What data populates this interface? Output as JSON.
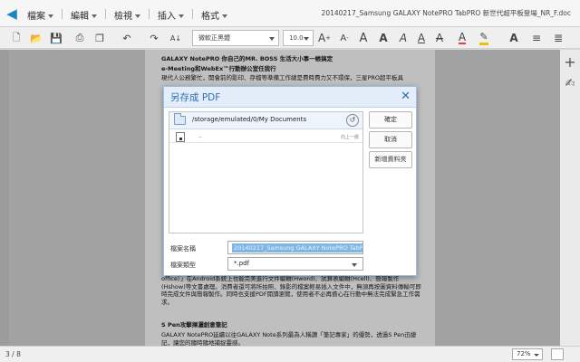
{
  "menubar": {
    "menus": [
      {
        "label": "檔案"
      },
      {
        "label": "編輯"
      },
      {
        "label": "檢視"
      },
      {
        "label": "插入"
      },
      {
        "label": "格式"
      }
    ],
    "doc_title": "20140217_Samsung GALAXY NotePRO TabPRO 新世代超平板登場_NR_F.doc"
  },
  "toolbar": {
    "font_name": "微軟正黑體",
    "font_size": "10.0"
  },
  "document": {
    "lines": [
      "GALAXY NotePRO 你自己的MR. BOSS  生活大小事一帳搞定",
      "e-Meeting和WebEx™行動辦公室任我行",
      "現代人公務繁忙，開會前的影印、存檔等準備工作總是費時費力又不環保，三星PRO超平板具",
      "office）」在Android系統上也能完美進行文件編輯(Hword)、試算表編輯(Hcell)、簡報製作(Hshow)等文書處理。消費者還可將所拍照、錄影的檔案輕易插入文件中，無須再按圖資料傳輸可即時完成文件與簡報製作。同時也支援PDF閱讀瀏覽，使用者不必再擔心在行動中無法完成緊急工作需求。",
      "S Pen攻擊揮灑創意筆記",
      "GALAXY NotePRO延續以往GALAXY Note系列最為人稱讚「筆記專家」的優勢，透過S Pen迅捷記，讓您的隨時隨地捕捉靈感。"
    ]
  },
  "dialog": {
    "title": "另存成 PDF",
    "path": "/storage/emulated/0/My Documents",
    "file_items": [
      {
        "name": "..",
        "desc": "向上一層"
      }
    ],
    "buttons": {
      "ok": "確定",
      "cancel": "取消",
      "new_folder": "新增資料夾"
    },
    "filename_label": "檔案名稱",
    "filename_value": "20140217_Samsung GALAXY NotePRO TabPRO 新世代超平板登場_NR_F",
    "filetype_label": "檔案類型",
    "filetype_value": "*.pdf"
  },
  "status": {
    "pages": "3 / 8",
    "zoom": "72%"
  },
  "colors": {
    "dialog_accent": "#2f6db3",
    "selection": "#7fb6e6",
    "font_color_underline": "#e04040",
    "highlight_underline": "#f0c000"
  },
  "icons": [
    "back-arrow-icon",
    "new-file-icon",
    "open-folder-icon",
    "save-icon",
    "print-icon",
    "undo-icon",
    "redo-icon",
    "format-painter-icon",
    "bold-text-icon",
    "font-color-icon",
    "highlighter-icon",
    "align-left-icon",
    "align-center-icon",
    "add-icon",
    "comment-icon",
    "folder-icon",
    "up-level-icon",
    "file-icon",
    "close-icon"
  ]
}
